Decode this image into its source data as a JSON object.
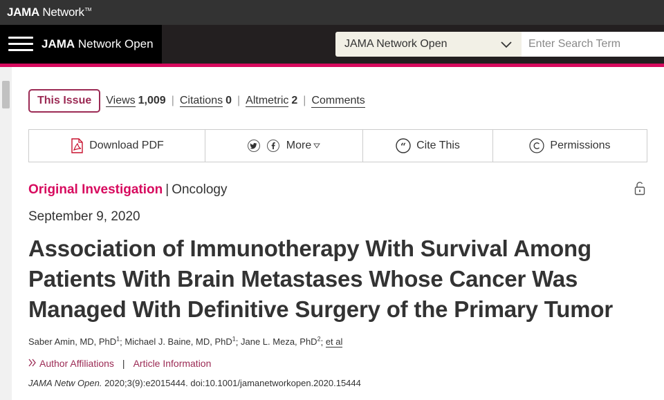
{
  "header": {
    "brand_bold": "JAMA",
    "brand_rest": " Network",
    "brand_tm": "TM",
    "journal_bold": "JAMA",
    "journal_rest": " Network Open",
    "journal_select_value": "JAMA Network Open",
    "search_placeholder": "Enter Search Term"
  },
  "metrics": {
    "this_issue": "This Issue",
    "views_label": "Views",
    "views_value": "1,009",
    "citations_label": "Citations",
    "citations_value": "0",
    "altmetric_label": "Altmetric",
    "altmetric_value": "2",
    "comments_label": "Comments",
    "separator": "|"
  },
  "toolbar": {
    "download_pdf": "Download PDF",
    "more": "More",
    "cite_this": "Cite This",
    "permissions": "Permissions"
  },
  "article": {
    "type": "Original Investigation",
    "pipe": "|",
    "topic": "Oncology",
    "date": "September 9, 2020",
    "title": "Association of Immunotherapy With Survival Among Patients With Brain Metastases Whose Cancer Was Managed With Definitive Surgery of the Primary Tumor",
    "authors": [
      {
        "name": "Saber Amin, MD, PhD",
        "sup": "1",
        "sep": "; "
      },
      {
        "name": "Michael J. Baine, MD, PhD",
        "sup": "1",
        "sep": "; "
      },
      {
        "name": "Jane L. Meza, PhD",
        "sup": "2",
        "sep": "; "
      }
    ],
    "et_al": "et al",
    "author_affiliations": "Author Affiliations",
    "article_information": "Article Information",
    "bar": "|",
    "journal_abbrev": "JAMA Netw Open.",
    "citation_rest": " 2020;3(9):e2015444. doi:10.1001/jamanetworkopen.2020.15444"
  },
  "colors": {
    "accent": "#d70a5e",
    "maroon": "#9b2a54",
    "topbar": "#333333"
  }
}
